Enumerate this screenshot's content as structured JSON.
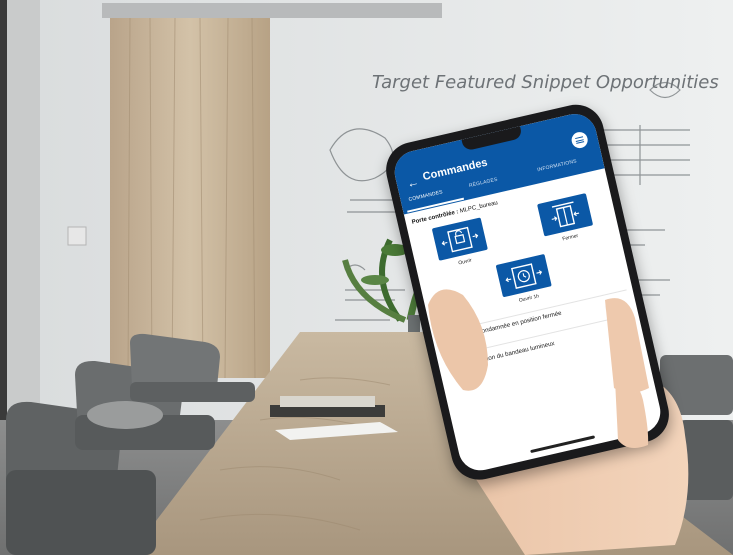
{
  "background": {
    "whiteboard_heading": "Target Featured Snippet Opportunities"
  },
  "app": {
    "title": "Commandes",
    "tabs": [
      "COMMANDES",
      "RÉGLAGES",
      "INFORMATIONS"
    ],
    "active_tab": "COMMANDES",
    "controlled_door_label": "Porte contrôlée :",
    "controlled_door_value": "MLPC_bureau",
    "buttons": {
      "open": "Ouvrir",
      "close": "Fermer",
      "open_1h": "Ouvrir 1h"
    },
    "settings": [
      {
        "label": "Porte condamnée en position fermée",
        "icon": "lock-icon",
        "enabled": false
      },
      {
        "label": "Activation du bandeau lumineux",
        "icon": "light-icon",
        "enabled": false
      }
    ],
    "colors": {
      "accent": "#0b58a6"
    }
  }
}
